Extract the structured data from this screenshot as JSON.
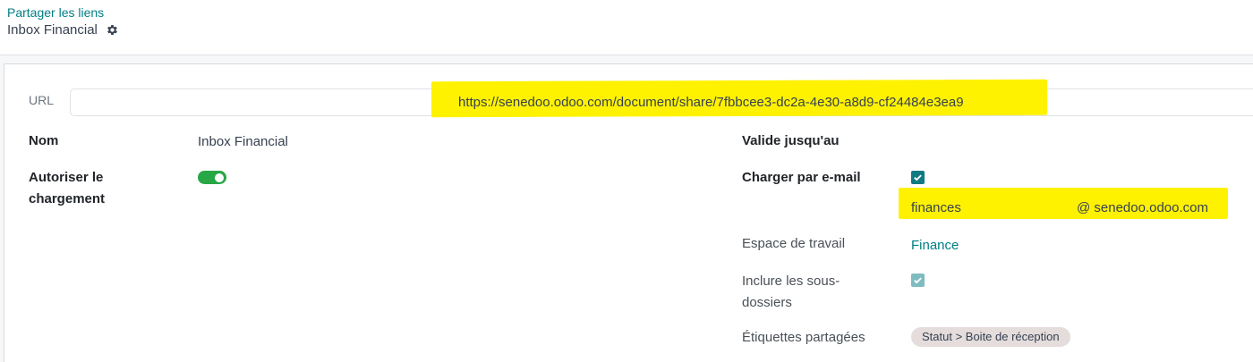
{
  "breadcrumb": {
    "parent": "Partager les liens",
    "current": "Inbox Financial"
  },
  "form": {
    "url": {
      "label": "URL",
      "value": "https://senedoo.odoo.com/document/share/7fbbcee3-dc2a-4e30-a8d9-cf24484e3ea9"
    },
    "name": {
      "label": "Nom",
      "value": "Inbox Financial"
    },
    "allow_upload": {
      "label_line1": "Autoriser le",
      "label_line2": "chargement",
      "enabled": true
    },
    "valid_until": {
      "label": "Valide jusqu'au",
      "value": ""
    },
    "upload_by_email": {
      "label": "Charger par e-mail",
      "checked": true,
      "alias": "finances",
      "domain": "@ senedoo.odoo.com"
    },
    "workspace": {
      "label": "Espace de travail",
      "value": "Finance"
    },
    "include_subfolders": {
      "label_line1": "Inclure les sous-",
      "label_line2": "dossiers",
      "checked": true
    },
    "shared_tags": {
      "label": "Étiquettes partagées",
      "tags": [
        "Statut > Boite de réception"
      ]
    }
  },
  "icons": {
    "settings": "gear-icon",
    "check": "check-icon"
  },
  "colors": {
    "accent": "#017e84",
    "toggle_on": "#28a745",
    "checkbox": "#0f7a82",
    "highlight": "#fff200"
  }
}
